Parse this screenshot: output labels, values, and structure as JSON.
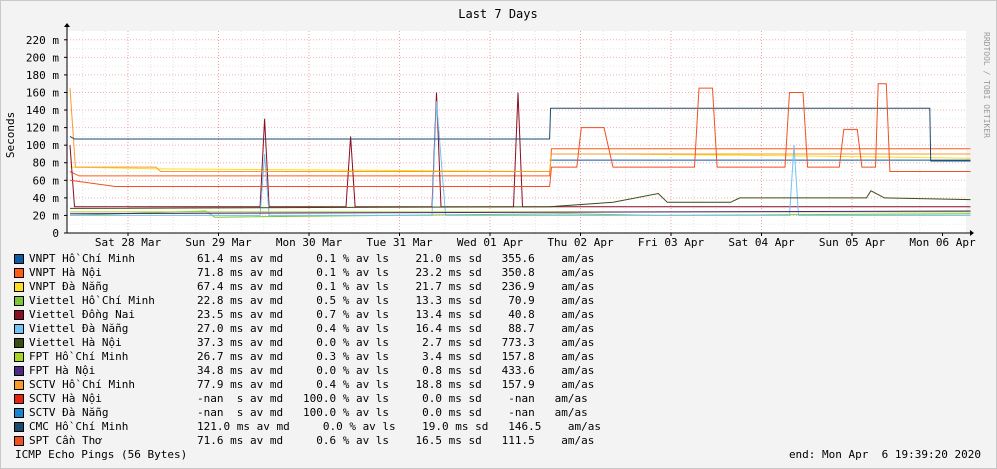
{
  "chart_data": {
    "type": "line",
    "title": "Last 7 Days",
    "ylabel": "Seconds",
    "watermark": "RRDTOOL / TOBI OETIKER",
    "y_ticks": [
      "0",
      "20 m",
      "40 m",
      "60 m",
      "80 m",
      "100 m",
      "120 m",
      "140 m",
      "160 m",
      "180 m",
      "200 m",
      "220 m"
    ],
    "ylim": [
      0,
      0.23
    ],
    "x_ticks": [
      "Sat 28 Mar",
      "Sun 29 Mar",
      "Mon 30 Mar",
      "Tue 31 Mar",
      "Wed 01 Apr",
      "Thu 02 Apr",
      "Fri 03 Apr",
      "Sat 04 Apr",
      "Sun 05 Apr",
      "Mon 06 Apr"
    ],
    "grid": true,
    "series": [
      {
        "name": "VNPT Hồ Chí Minh",
        "color": "#0f5ba0",
        "stats": "61.4 ms av md     0.1 % av ls    21.0 ms sd   355.6    am/as"
      },
      {
        "name": "VNPT Hà Nội",
        "color": "#ff5d17",
        "stats": "71.8 ms av md     0.1 % av ls    23.2 ms sd   350.8    am/as"
      },
      {
        "name": "VNPT Đà Nẵng",
        "color": "#ffdd23",
        "stats": "67.4 ms av md     0.1 % av ls    21.7 ms sd   236.9    am/as"
      },
      {
        "name": "Viettel Hồ Chí Minh",
        "color": "#7cc63a",
        "stats": "22.8 ms av md     0.5 % av ls    13.3 ms sd    70.9    am/as"
      },
      {
        "name": "Viettel Đồng Nai",
        "color": "#8a0d24",
        "stats": "23.5 ms av md     0.7 % av ls    13.4 ms sd    40.8    am/as"
      },
      {
        "name": "Viettel Đà Nẵng",
        "color": "#72c2f5",
        "stats": "27.0 ms av md     0.4 % av ls    16.4 ms sd    88.7    am/as"
      },
      {
        "name": "Viettel Hà Nội",
        "color": "#3c4d14",
        "stats": "37.3 ms av md     0.0 % av ls     2.7 ms sd   773.3    am/as"
      },
      {
        "name": "FPT Hồ Chí Minh",
        "color": "#a8d524",
        "stats": "26.7 ms av md     0.3 % av ls     3.4 ms sd   157.8    am/as"
      },
      {
        "name": "FPT Hà Nội",
        "color": "#4f2a82",
        "stats": "34.8 ms av md     0.0 % av ls     0.8 ms sd   433.6    am/as"
      },
      {
        "name": "SCTV Hồ Chí Minh",
        "color": "#f99a2d",
        "stats": "77.9 ms av md     0.4 % av ls    18.8 ms sd   157.9    am/as"
      },
      {
        "name": "SCTV Hà Nội",
        "color": "#e3240f",
        "stats": "-nan  s av md   100.0 % av ls     0.0 ms sd    -nan   am/as"
      },
      {
        "name": "SCTV Đà Nẵng",
        "color": "#1c84cd",
        "stats": "-nan  s av md   100.0 % av ls     0.0 ms sd    -nan   am/as"
      },
      {
        "name": "CMC Hồ Chí Minh",
        "color": "#1b4a6f",
        "stats": "121.0 ms av md     0.0 % av ls    19.0 ms sd   146.5    am/as"
      },
      {
        "name": "SPT Cần Thơ",
        "color": "#ef5123",
        "stats": "71.6 ms av md     0.6 % av ls    16.5 ms sd   111.5    am/as"
      }
    ]
  },
  "footer": {
    "left": "ICMP Echo Pings (56 Bytes)",
    "right": "end: Mon Apr  6 19:39:20 2020"
  }
}
